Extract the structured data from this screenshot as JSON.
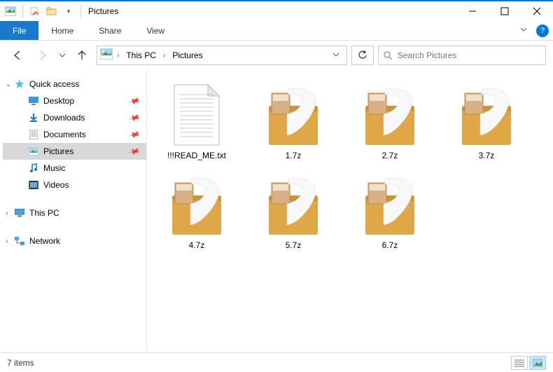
{
  "window": {
    "title": "Pictures"
  },
  "ribbon": {
    "file": "File",
    "tabs": [
      "Home",
      "Share",
      "View"
    ]
  },
  "breadcrumbs": [
    "This PC",
    "Pictures"
  ],
  "search": {
    "placeholder": "Search Pictures"
  },
  "sidebar": {
    "quick_access": {
      "label": "Quick access"
    },
    "items": [
      {
        "label": "Desktop"
      },
      {
        "label": "Downloads"
      },
      {
        "label": "Documents"
      },
      {
        "label": "Pictures"
      },
      {
        "label": "Music"
      },
      {
        "label": "Videos"
      }
    ],
    "this_pc": {
      "label": "This PC"
    },
    "network": {
      "label": "Network"
    }
  },
  "files": [
    {
      "name": "!!!READ_ME.txt",
      "type": "txt"
    },
    {
      "name": "1.7z",
      "type": "archive"
    },
    {
      "name": "2.7z",
      "type": "archive"
    },
    {
      "name": "3.7z",
      "type": "archive"
    },
    {
      "name": "4.7z",
      "type": "archive"
    },
    {
      "name": "5.7z",
      "type": "archive"
    },
    {
      "name": "6.7z",
      "type": "archive"
    }
  ],
  "status": {
    "item_count": "7 items"
  }
}
